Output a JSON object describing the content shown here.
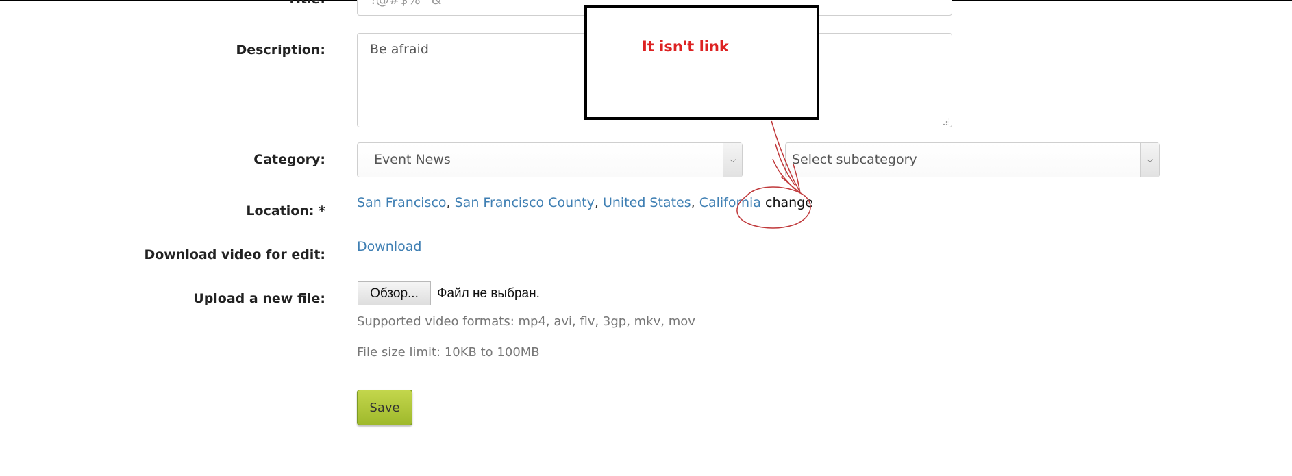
{
  "form": {
    "title": {
      "label": "Title:",
      "value": "!@#$%^&"
    },
    "description": {
      "label": "Description:",
      "value": "Be afraid"
    },
    "category": {
      "label": "Category:",
      "selected": "Event News",
      "subcategory_placeholder": "Select subcategory"
    },
    "location": {
      "label": "Location: *",
      "links": [
        "San Francisco",
        "San Francisco County",
        "United States",
        "California"
      ],
      "separator": ", ",
      "change_text": "change"
    },
    "download": {
      "label": "Download video for edit:",
      "link_text": "Download"
    },
    "upload": {
      "label": "Upload a new file:",
      "browse_button": "Обзор...",
      "file_status": "Файл не выбран.",
      "supported_formats": "Supported video formats: mp4, avi, flv, 3gp, mkv, mov",
      "size_limit": "File size limit: 10KB to 100MB"
    },
    "save_button": "Save"
  },
  "annotation": {
    "callout_text": "It isn't link",
    "callout_color": "#dd2222",
    "mark_color": "#c0393b"
  },
  "colors": {
    "link": "#3f7fb3",
    "save_button": "#a9c23a",
    "label": "#222222"
  }
}
